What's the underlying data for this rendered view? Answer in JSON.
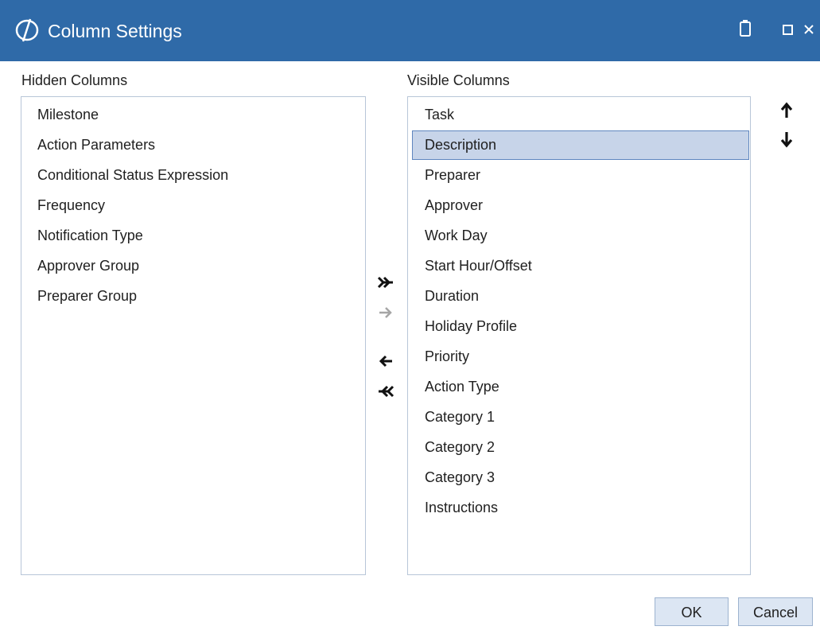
{
  "window": {
    "title": "Column Settings"
  },
  "hidden_columns": {
    "label": "Hidden Columns",
    "items": [
      "Milestone",
      "Action Parameters",
      "Conditional Status Expression",
      "Frequency",
      "Notification Type",
      "Approver Group",
      "Preparer Group"
    ]
  },
  "visible_columns": {
    "label": "Visible Columns",
    "items": [
      "Task",
      "Description",
      "Preparer",
      "Approver",
      "Work Day",
      "Start Hour/Offset",
      "Duration",
      "Holiday Profile",
      "Priority",
      "Action Type",
      "Category 1",
      "Category 2",
      "Category 3",
      "Instructions"
    ],
    "selected": "Description"
  },
  "buttons": {
    "ok": "OK",
    "cancel": "Cancel"
  },
  "colors": {
    "titlebar": "#2f6aa8",
    "selection": "#c7d4e9",
    "selection_border": "#5f86bf",
    "disabled_arrow": "#a6a6a6"
  }
}
